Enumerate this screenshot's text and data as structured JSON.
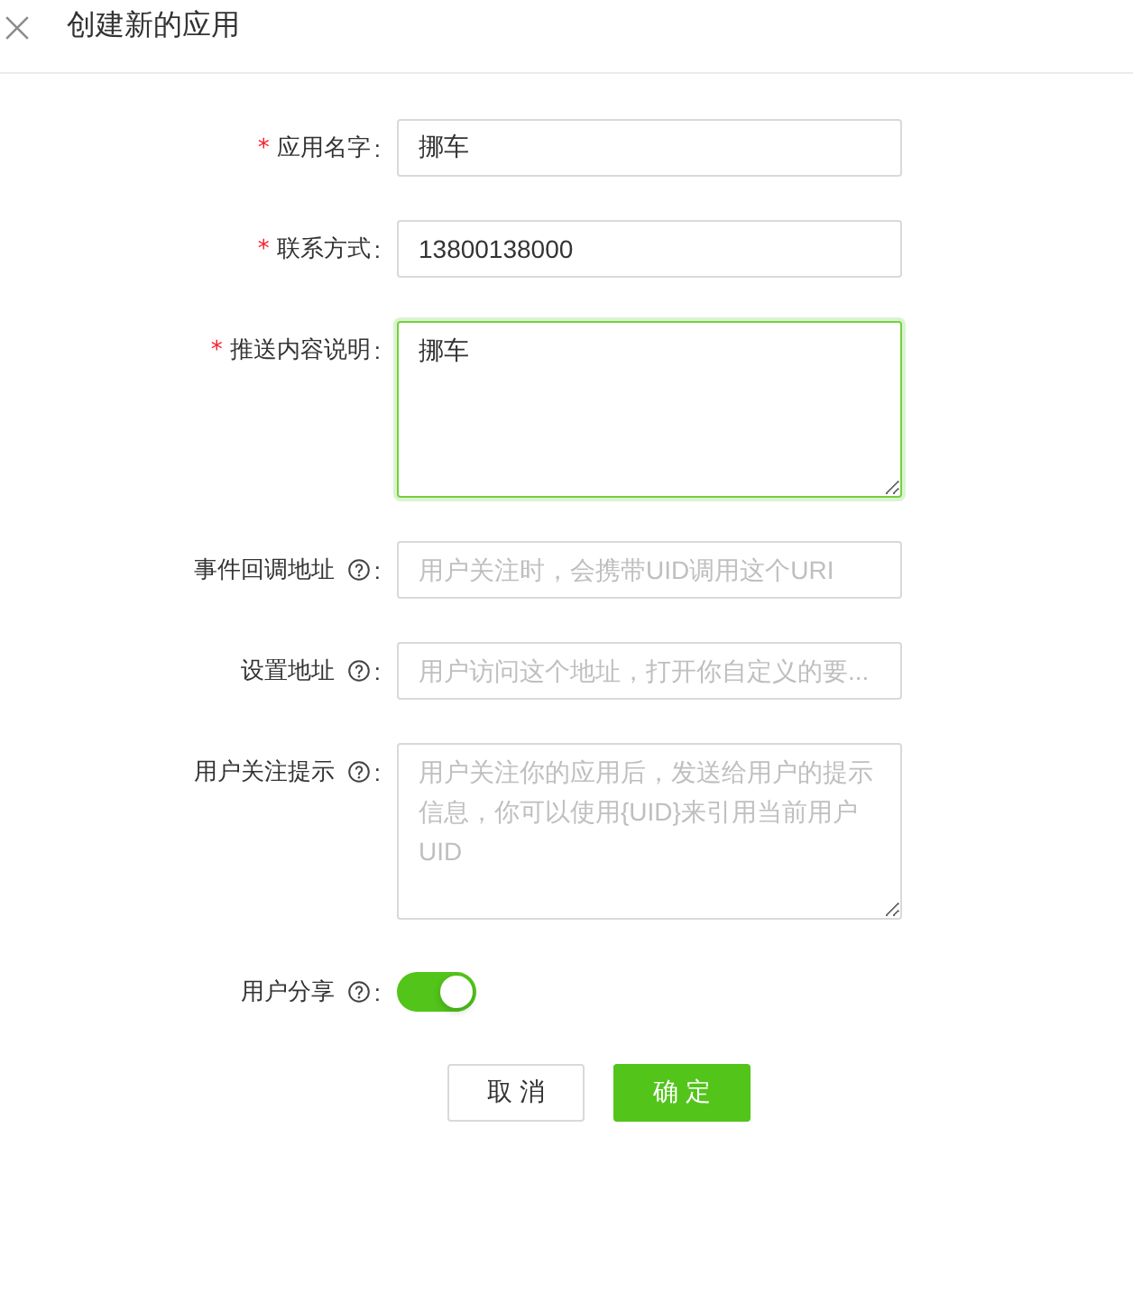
{
  "dialog": {
    "title": "创建新的应用"
  },
  "form": {
    "fields": [
      {
        "kind": "input",
        "required_mark": "*",
        "label": "应用名字",
        "help": false,
        "colon": ":",
        "value": "挪车",
        "focused": false
      },
      {
        "kind": "input",
        "required_mark": "*",
        "label": "联系方式",
        "help": false,
        "colon": ":",
        "value": "13800138000",
        "focused": false
      },
      {
        "kind": "textarea",
        "required_mark": "*",
        "label": "推送内容说明",
        "help": false,
        "colon": ":",
        "value": "挪车",
        "focused": true
      },
      {
        "kind": "input",
        "label": "事件回调地址",
        "help": true,
        "colon": ":",
        "placeholder": "用户关注时，会携带UID调用这个URI",
        "focused": false
      },
      {
        "kind": "input",
        "label": "设置地址",
        "help": true,
        "colon": ":",
        "placeholder": "用户访问这个地址，打开你自定义的要...",
        "focused": false
      },
      {
        "kind": "textarea",
        "label": "用户关注提示",
        "help": true,
        "colon": ":",
        "placeholder": "用户关注你的应用后，发送给用户的提示信息，你可以使用{UID}来引用当前用户UID",
        "focused": false
      },
      {
        "kind": "switch",
        "label": "用户分享",
        "help": true,
        "colon": ":",
        "on": true
      }
    ],
    "buttons": [
      {
        "kind": "default",
        "label": "取 消"
      },
      {
        "kind": "primary",
        "label": "确 定"
      }
    ]
  }
}
